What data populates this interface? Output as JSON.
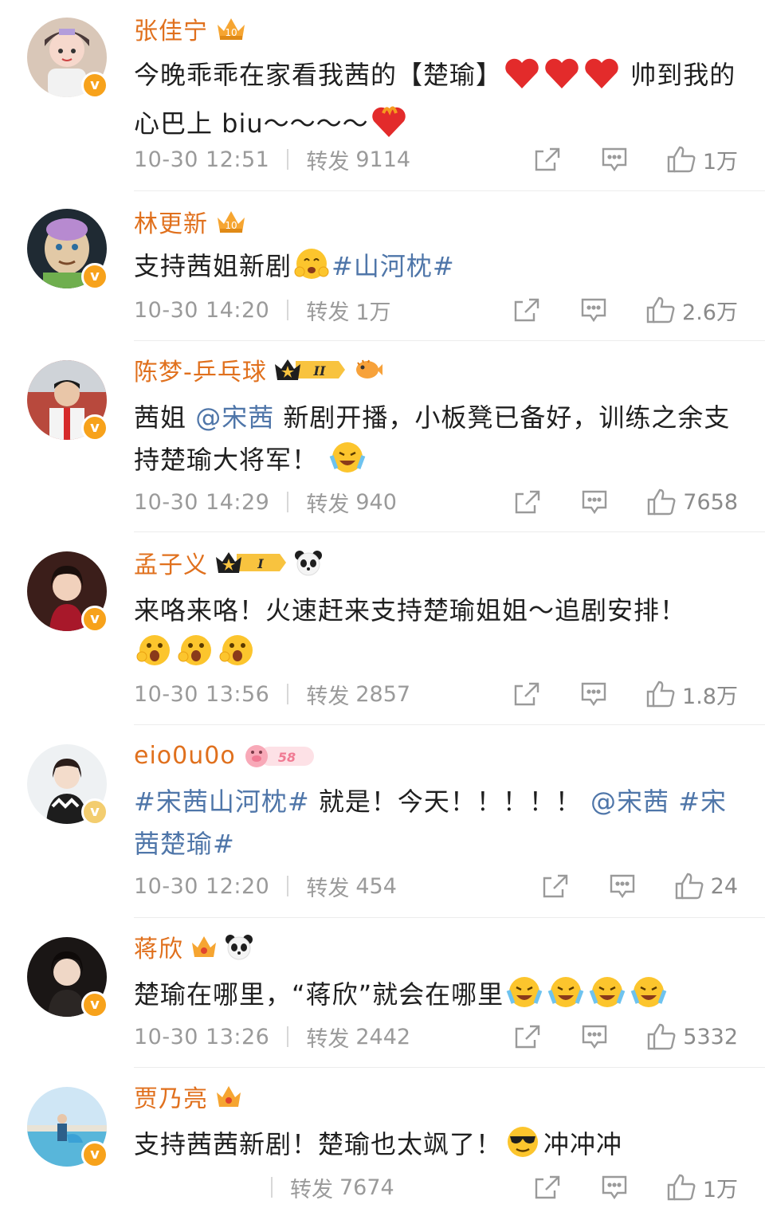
{
  "colors": {
    "name": "#e0701d",
    "topic": "#4f76a9",
    "meta": "#9a9a9a",
    "verified": "#f7a21b"
  },
  "posts": [
    {
      "user": "张佳宁",
      "text_parts": [
        "今晚乖乖在家看我茜的【楚瑜】",
        "帅到我的心巴上 biu～～～～"
      ],
      "time": "10-30 12:51",
      "repost_label": "转发",
      "repost_count": "9114",
      "likes": "1万"
    },
    {
      "user": "林更新",
      "text_parts": [
        "支持茜姐新剧",
        "#山河枕#"
      ],
      "time": "10-30 14:20",
      "repost_label": "转发",
      "repost_count": "1万",
      "likes": "2.6万"
    },
    {
      "user": "陈梦-乒乓球",
      "level": "II",
      "text_parts": [
        "茜姐 ",
        "@宋茜",
        " 新剧开播，小板凳已备好，训练之余支持楚瑜大将军！"
      ],
      "time": "10-30 14:29",
      "repost_label": "转发",
      "repost_count": "940",
      "likes": "7658"
    },
    {
      "user": "孟子义",
      "level": "I",
      "text_parts": [
        "来咯来咯！火速赶来支持楚瑜姐姐～追剧安排！"
      ],
      "time": "10-30 13:56",
      "repost_label": "转发",
      "repost_count": "2857",
      "likes": "1.8万"
    },
    {
      "user": "eio0u0o",
      "level": "58",
      "text_parts": [
        "#宋茜山河枕#",
        " 就是！今天！！！！！ ",
        "@宋茜",
        " ",
        "#宋茜楚瑜#"
      ],
      "time": "10-30 12:20",
      "repost_label": "转发",
      "repost_count": "454",
      "likes": "24"
    },
    {
      "user": "蒋欣",
      "text_parts": [
        "楚瑜在哪里，“蒋欣”就会在哪里"
      ],
      "time": "10-30 13:26",
      "repost_label": "转发",
      "repost_count": "2442",
      "likes": "5332"
    },
    {
      "user": "贾乃亮",
      "text_parts": [
        "支持茜茜新剧！楚瑜也太飒了！",
        "冲冲冲"
      ],
      "time": "",
      "repost_label": "转发",
      "repost_count": "7674",
      "likes": "1万"
    }
  ]
}
